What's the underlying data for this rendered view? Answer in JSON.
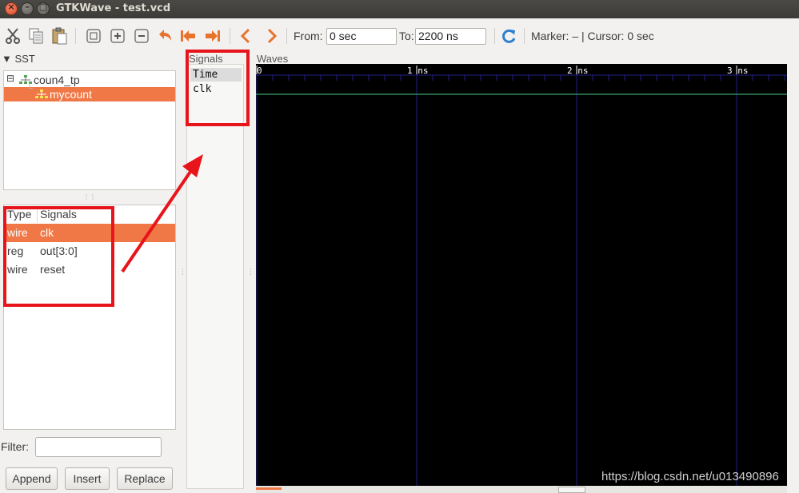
{
  "window": {
    "title": "GTKWave - test.vcd",
    "close_glyph": "×",
    "min_glyph": "–",
    "max_glyph": "□"
  },
  "toolbar": {
    "icons": [
      "cut-icon",
      "copy-icon",
      "paste-icon",
      "zoom-fit-icon",
      "zoom-in-icon",
      "zoom-out-icon",
      "undo-zoom-icon",
      "zoom-to-start-icon",
      "zoom-to-end-icon",
      "previous-icon",
      "next-icon",
      "reload-icon"
    ],
    "from_label": "From:",
    "from_value": "0 sec",
    "to_label": "To:",
    "to_value": "2200 ns",
    "marker_text": "Marker: – | Cursor: 0 sec"
  },
  "sst": {
    "title": "SST",
    "tree": [
      {
        "label": "coun4_tp",
        "expander": "⊟"
      },
      {
        "label": "mycount",
        "selected": true
      }
    ],
    "columns": {
      "type": "Type",
      "signals": "Signals"
    },
    "rows": [
      {
        "type": "wire",
        "name": "clk",
        "selected": true
      },
      {
        "type": "reg",
        "name": "out[3:0]"
      },
      {
        "type": "wire",
        "name": "reset"
      }
    ],
    "filter_label": "Filter:",
    "filter_value": "",
    "buttons": {
      "append": "Append",
      "insert": "Insert",
      "replace": "Replace"
    }
  },
  "signals_panel": {
    "title": "Signals",
    "items": [
      "Time",
      "clk"
    ]
  },
  "waves": {
    "title": "Waves",
    "ticks": [
      {
        "label": "0",
        "ns": 0
      },
      {
        "label": "1 ns",
        "ns": 1
      },
      {
        "label": "2 ns",
        "ns": 2
      },
      {
        "label": "3 ns",
        "ns": 3
      }
    ],
    "colors": {
      "background": "#000000",
      "ruler": "#ffffff",
      "gridline": "#20208a",
      "trace": "#2e8b57"
    }
  },
  "watermark": "https://blog.csdn.net/u013490896",
  "colors": {
    "selection": "#f07746",
    "annotation": "#e8141b"
  }
}
